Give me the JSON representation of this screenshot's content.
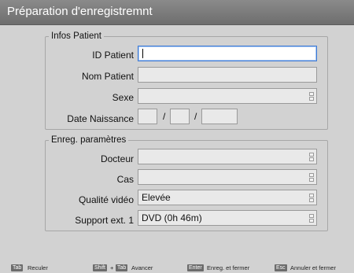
{
  "window": {
    "title": "Préparation d'enregistremnt"
  },
  "patient_group": {
    "legend": "Infos Patient",
    "id_label": "ID Patient",
    "id_value": "",
    "name_label": "Nom Patient",
    "name_value": "",
    "sex_label": "Sexe",
    "sex_value": "",
    "dob_label": "Date Naissance",
    "dob_sep": "/"
  },
  "settings_group": {
    "legend": "Enreg. paramètres",
    "doctor_label": "Docteur",
    "doctor_value": "",
    "case_label": "Cas",
    "case_value": "",
    "quality_label": "Qualité vidéo",
    "quality_value": "Elevée",
    "support_label": "Support ext. 1",
    "support_value": "DVD (0h 46m)"
  },
  "footer": {
    "tab_key": "Tab",
    "back_label": "Reculer",
    "shift_key": "Shift",
    "plus": "+",
    "tab_key2": "Tab",
    "forward_label": "Avancer",
    "enter_key": "Enter",
    "save_label": "Enreg. et fermer",
    "esc_key": "Esc",
    "cancel_label": "Annuler et fermer"
  },
  "colors": {
    "titlebar": "#7a7a7a",
    "focus_border": "#3d7ad6",
    "background": "#d2d2d2"
  }
}
